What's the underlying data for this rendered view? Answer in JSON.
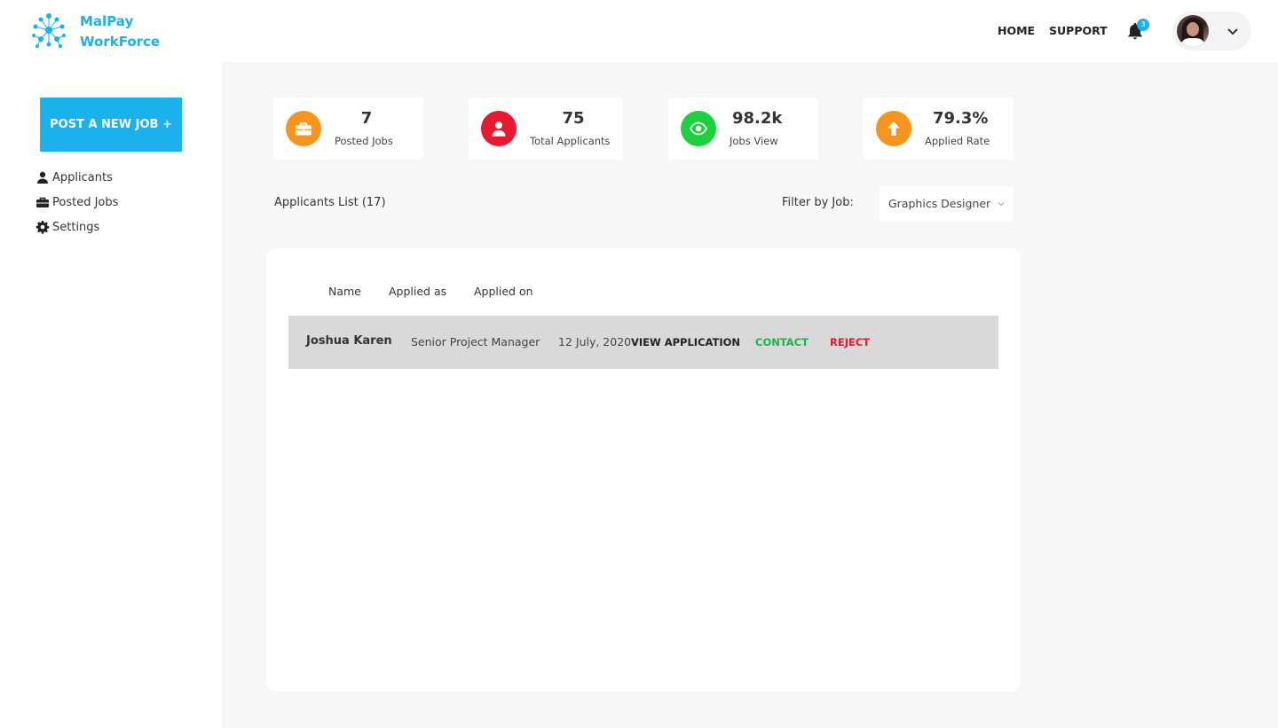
{
  "brand": {
    "line1": "MalPay",
    "line2": "WorkForce",
    "color": "#1ab1ec"
  },
  "nav": {
    "home": "HOME",
    "support": "SUPPORT"
  },
  "notifications": {
    "count": "3",
    "icon": "bell-icon"
  },
  "profile": {
    "dropdown_icon": "chevron-down-icon"
  },
  "sidebar": {
    "post_button": "POST A NEW JOB +",
    "items": [
      {
        "label": "Applicants",
        "icon": "person-icon"
      },
      {
        "label": "Posted Jobs",
        "icon": "briefcase-icon"
      },
      {
        "label": "Settings",
        "icon": "gear-icon"
      }
    ]
  },
  "stats": [
    {
      "value": "7",
      "label": "Posted Jobs",
      "icon": "briefcase-icon",
      "color": "#f7941d"
    },
    {
      "value": "75",
      "label": "Total Applicants",
      "icon": "person-icon",
      "color": "#e8182e"
    },
    {
      "value": "98.2k",
      "label": "Jobs View",
      "icon": "eye-icon",
      "color": "#1cd13e"
    },
    {
      "value": "79.3%",
      "label": "Applied Rate",
      "icon": "arrow-up-icon",
      "color": "#f7941d"
    }
  ],
  "applicants": {
    "title": "Applicants List (17)",
    "filter_label": "Filter by Job:",
    "filter_value": "Graphics Designer",
    "columns": [
      "Name",
      "Applied as",
      "Applied on"
    ],
    "rows": [
      {
        "name": "Joshua Karen",
        "applied_as": "Senior Project Manager",
        "applied_on": "12 July, 2020",
        "view": "VIEW APPLICATION",
        "contact": "CONTACT",
        "reject": "REJECT"
      }
    ]
  },
  "colors": {
    "contact": "#1cb34a",
    "reject": "#e8182e",
    "accent": "#1ab1ec"
  }
}
